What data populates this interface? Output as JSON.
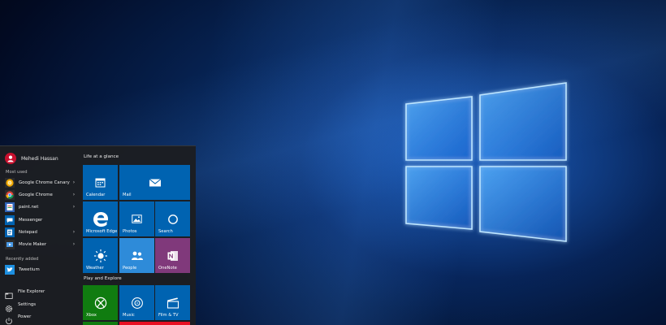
{
  "start_menu": {
    "user": {
      "name": "Mehedi Hassan"
    },
    "most_used_label": "Most used",
    "most_used": [
      {
        "label": "Google Chrome Canary",
        "icon": "chrome-canary-icon",
        "has_submenu": true
      },
      {
        "label": "Google Chrome",
        "icon": "chrome-icon",
        "has_submenu": true
      },
      {
        "label": "paint.net",
        "icon": "paintnet-icon",
        "has_submenu": true
      },
      {
        "label": "Messenger",
        "icon": "messenger-icon",
        "has_submenu": false
      },
      {
        "label": "Notepad",
        "icon": "notepad-icon",
        "has_submenu": true
      },
      {
        "label": "Movie Maker",
        "icon": "movie-maker-icon",
        "has_submenu": true
      }
    ],
    "recently_added_label": "Recently added",
    "recently_added": [
      {
        "label": "Tweetium",
        "icon": "tweetium-icon"
      }
    ],
    "system": [
      {
        "label": "File Explorer",
        "icon": "file-explorer-icon"
      },
      {
        "label": "Settings",
        "icon": "settings-icon"
      },
      {
        "label": "Power",
        "icon": "power-icon"
      }
    ],
    "chevron": "›",
    "groups": [
      {
        "label": "Life at a glance",
        "tiles": [
          {
            "label": "Calendar",
            "icon": "calendar-icon",
            "color": "#0063b1"
          },
          {
            "label": "Mail",
            "icon": "mail-icon",
            "color": "#0063b1"
          },
          {
            "label": "Microsoft Edge",
            "icon": "edge-icon",
            "color": "#0063b1"
          },
          {
            "label": "Photos",
            "icon": "photos-icon",
            "color": "#0063b1"
          },
          {
            "label": "Search",
            "icon": "search-icon",
            "color": "#0063b1"
          },
          {
            "label": "Weather",
            "icon": "weather-icon",
            "color": "#0063b1"
          },
          {
            "label": "People",
            "icon": "people-icon",
            "color": "#2e8bd9"
          },
          {
            "label": "OneNote",
            "icon": "onenote-icon",
            "color": "#80397b"
          }
        ]
      },
      {
        "label": "Play and Explore",
        "tiles": [
          {
            "label": "Xbox",
            "icon": "xbox-icon",
            "color": "#107c10"
          },
          {
            "label": "Music",
            "icon": "music-icon",
            "color": "#0063b1"
          },
          {
            "label": "Film & TV",
            "icon": "film-tv-icon",
            "color": "#0063b1"
          }
        ]
      }
    ]
  },
  "colors": {
    "start_bg": "#1c1e22",
    "accent": "#0063b1",
    "avatar": "#c8102e"
  }
}
